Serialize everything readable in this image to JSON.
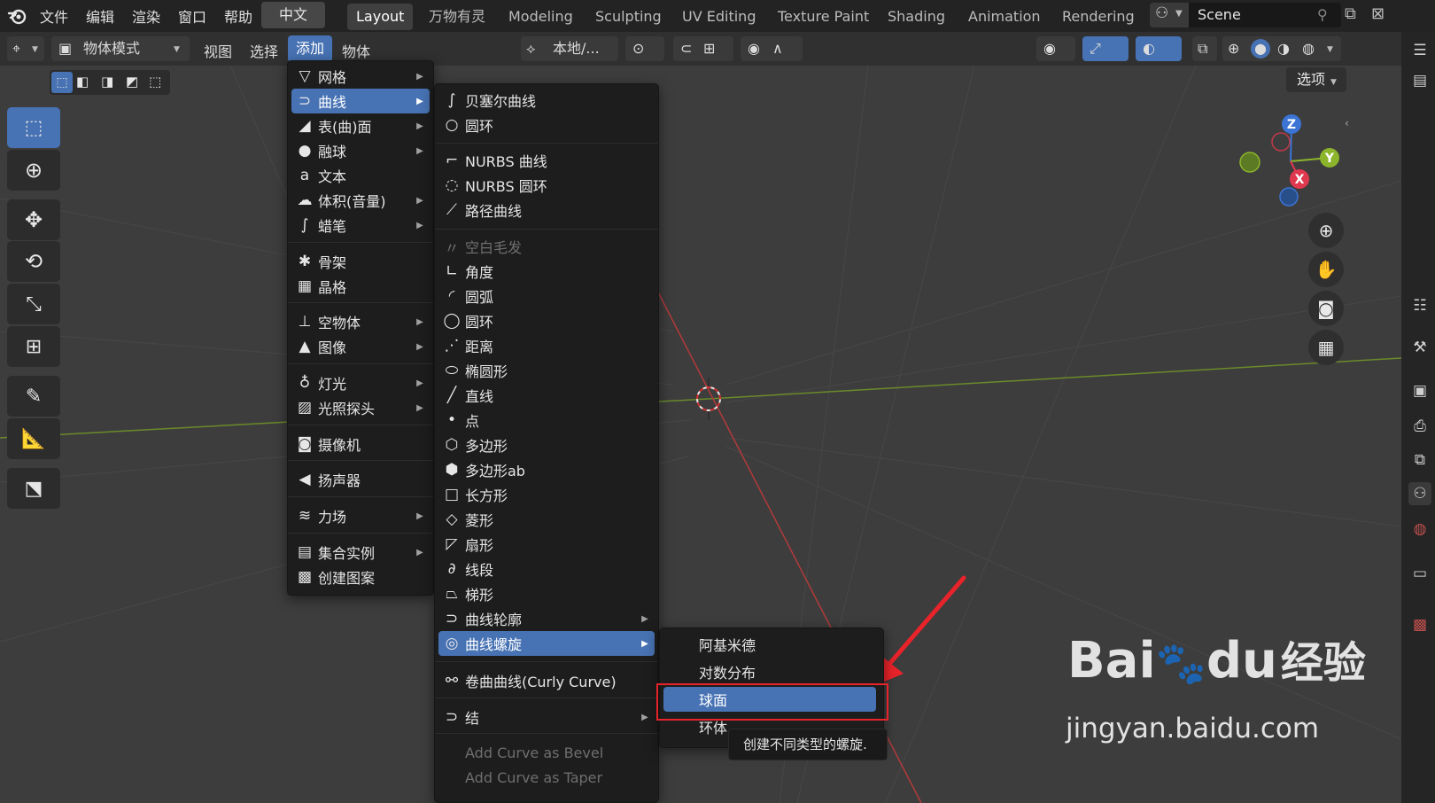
{
  "topbar": {
    "menus": [
      "文件",
      "编辑",
      "渲染",
      "窗口",
      "帮助"
    ],
    "language": "中文",
    "workspaces": [
      "Layout",
      "万物有灵",
      "Modeling",
      "Sculpting",
      "UV Editing",
      "Texture Paint",
      "Shading",
      "Animation",
      "Rendering"
    ],
    "active_workspace": "Layout",
    "scene": "Scene"
  },
  "header": {
    "mode": "物体模式",
    "menus": [
      "视图",
      "选择",
      "添加",
      "物体"
    ],
    "active_menu": "添加",
    "transform_orientation": "本地/...",
    "options": "选项"
  },
  "add_menu": {
    "items": [
      {
        "label": "网格",
        "icon": "mesh-icon",
        "glyph": "▽",
        "submenu": true
      },
      {
        "label": "曲线",
        "icon": "curve-icon",
        "glyph": "⊃",
        "submenu": true,
        "highlight": true
      },
      {
        "label": "表(曲)面",
        "icon": "surface-icon",
        "glyph": "◢",
        "submenu": true
      },
      {
        "label": "融球",
        "icon": "metaball-icon",
        "glyph": "●",
        "submenu": true
      },
      {
        "label": "文本",
        "icon": "text-icon",
        "glyph": "a",
        "submenu": false
      },
      {
        "label": "体积(音量)",
        "icon": "volume-icon",
        "glyph": "☁",
        "submenu": true
      },
      {
        "label": "蜡笔",
        "icon": "grease-pencil-icon",
        "glyph": "∫",
        "submenu": true
      },
      {
        "label": "骨架",
        "icon": "armature-icon",
        "glyph": "✱",
        "submenu": false
      },
      {
        "label": "晶格",
        "icon": "lattice-icon",
        "glyph": "▦",
        "submenu": false
      },
      {
        "label": "空物体",
        "icon": "empty-icon",
        "glyph": "⊥",
        "submenu": true
      },
      {
        "label": "图像",
        "icon": "image-icon",
        "glyph": "▲",
        "submenu": true
      },
      {
        "label": "灯光",
        "icon": "light-icon",
        "glyph": "♁",
        "submenu": true
      },
      {
        "label": "光照探头",
        "icon": "light-probe-icon",
        "glyph": "▨",
        "submenu": true
      },
      {
        "label": "摄像机",
        "icon": "camera-icon",
        "glyph": "◙",
        "submenu": false
      },
      {
        "label": "扬声器",
        "icon": "speaker-icon",
        "glyph": "◀",
        "submenu": false
      },
      {
        "label": "力场",
        "icon": "force-field-icon",
        "glyph": "≋",
        "submenu": true
      },
      {
        "label": "集合实例",
        "icon": "collection-instance-icon",
        "glyph": "▤",
        "submenu": true
      },
      {
        "label": "创建图案",
        "icon": "pattern-icon",
        "glyph": "▩",
        "submenu": false
      }
    ]
  },
  "curve_menu": {
    "items": [
      {
        "label": "贝塞尔曲线",
        "icon": "bezier-curve-icon",
        "glyph": "∫"
      },
      {
        "label": "圆环",
        "icon": "bezier-circle-icon",
        "glyph": "○"
      },
      {
        "label": "NURBS 曲线",
        "icon": "nurbs-curve-icon",
        "glyph": "⌐"
      },
      {
        "label": "NURBS 圆环",
        "icon": "nurbs-circle-icon",
        "glyph": "◌"
      },
      {
        "label": "路径曲线",
        "icon": "path-icon",
        "glyph": "⟋"
      },
      {
        "label": "空白毛发",
        "icon": "hair-icon",
        "glyph": "〃",
        "disabled": true
      },
      {
        "label": "角度",
        "icon": "angle-icon",
        "glyph": "∟"
      },
      {
        "label": "圆弧",
        "icon": "arc-icon",
        "glyph": "◜"
      },
      {
        "label": "圆环",
        "icon": "circle-icon",
        "glyph": "◯"
      },
      {
        "label": "距离",
        "icon": "distance-icon",
        "glyph": "⋰"
      },
      {
        "label": "椭圆形",
        "icon": "ellipse-icon",
        "glyph": "⬭"
      },
      {
        "label": "直线",
        "icon": "line-icon",
        "glyph": "╱"
      },
      {
        "label": "点",
        "icon": "point-icon",
        "glyph": "•"
      },
      {
        "label": "多边形",
        "icon": "polygon-icon",
        "glyph": "⬡"
      },
      {
        "label": "多边形ab",
        "icon": "polygon-ab-icon",
        "glyph": "⬢"
      },
      {
        "label": "长方形",
        "icon": "rectangle-icon",
        "glyph": "□"
      },
      {
        "label": "菱形",
        "icon": "rhomb-icon",
        "glyph": "◇"
      },
      {
        "label": "扇形",
        "icon": "sector-icon",
        "glyph": "◸"
      },
      {
        "label": "线段",
        "icon": "segment-icon",
        "glyph": "∂"
      },
      {
        "label": "梯形",
        "icon": "trapezoid-icon",
        "glyph": "⏢"
      },
      {
        "label": "曲线轮廓",
        "icon": "curve-profile-icon",
        "glyph": "⊃",
        "submenu": true
      },
      {
        "label": "曲线螺旋",
        "icon": "spiral-icon",
        "glyph": "◎",
        "submenu": true,
        "highlight": true
      },
      {
        "label": "卷曲曲线(Curly Curve)",
        "icon": "curly-curve-icon",
        "glyph": "⚯"
      },
      {
        "label": "结",
        "icon": "knot-icon",
        "glyph": "⊃",
        "submenu": true
      },
      {
        "label": "Add Curve as Bevel",
        "icon": "",
        "glyph": "",
        "disabled": true
      },
      {
        "label": "Add Curve as Taper",
        "icon": "",
        "glyph": "",
        "disabled": true
      }
    ]
  },
  "spiral_menu": {
    "items": [
      "阿基米德",
      "对数分布",
      "球面",
      "环体"
    ],
    "highlight": "球面",
    "tooltip": "创建不同类型的螺旋."
  },
  "gizmo": {
    "z": "Z",
    "y": "Y",
    "x": "X"
  },
  "watermark": {
    "brand": "Bai",
    "brand2": "du",
    "suffix": "经验",
    "url": "jingyan.baidu.com"
  },
  "colors": {
    "accent": "#4772b3",
    "annotation": "#e8232a",
    "x_axis": "#b33a3a",
    "y_axis": "#6b8a2a"
  }
}
